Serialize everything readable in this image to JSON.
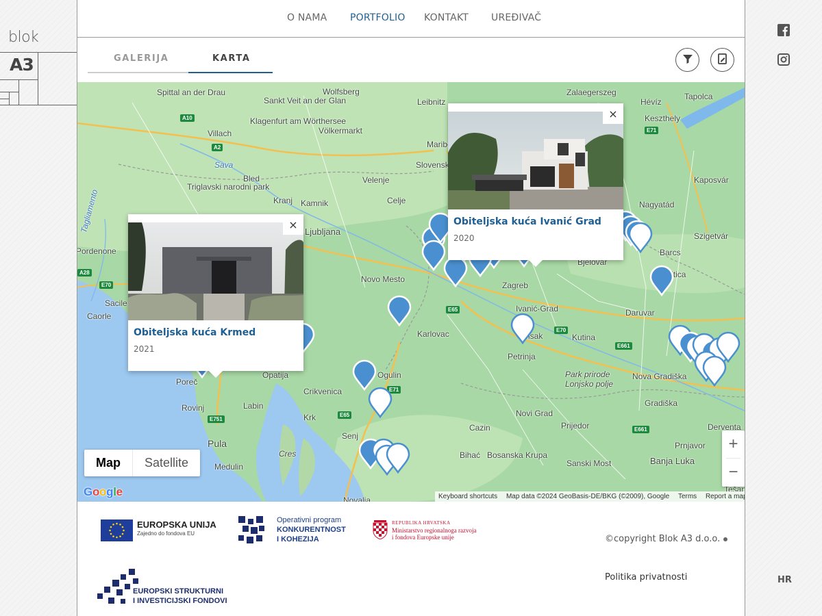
{
  "brand": {
    "line1": "blok",
    "line2": "A3"
  },
  "nav": {
    "items": [
      {
        "label": "O NAMA",
        "active": false
      },
      {
        "label": "PORTFOLIO",
        "active": true
      },
      {
        "label": "KONTAKT",
        "active": false
      },
      {
        "label": "UREĐIVAČ",
        "active": false
      }
    ]
  },
  "tabs": [
    {
      "label": "GALERIJA",
      "active": false
    },
    {
      "label": "KARTA",
      "active": true
    }
  ],
  "toolbar": {
    "filter_icon": "filter-icon",
    "document_icon": "document-edit-icon"
  },
  "map": {
    "place_labels": [
      "Spittal an der Drau",
      "Wolfsberg",
      "Leibnitz",
      "Zalaegerszeg",
      "Hévíz",
      "Tapolca",
      "Sankt Veit an der Glan",
      "Keszthely",
      "Villach",
      "Klagenfurt am Wörthersee",
      "Völkermarkt",
      "Maribor",
      "Slovenska Bistrica",
      "Sava",
      "Bled",
      "Triglavski narodni park",
      "Velenje",
      "Celje",
      "Kaposvár",
      "Kranj",
      "Kamnik",
      "Nagyatád",
      "Ljubljana",
      "Tagliamento",
      "Szigetvár",
      "Novo Mesto",
      "Barcs",
      "Bjelovar",
      "Virovitica",
      "Sacile",
      "Caorle",
      "Zagreb",
      "Ivanić-Grad",
      "Daruvar",
      "Karlovac",
      "Sisak",
      "Kutina",
      "Poreč",
      "Opatija",
      "Petrinja",
      "Park prirode Lonjsko polje",
      "Nova Gradiška",
      "Rovinj",
      "Crikvenica",
      "Ogulin",
      "Gradiška",
      "Labin",
      "Krk",
      "Novi Grad",
      "Derventa",
      "Senj",
      "Cazin",
      "Prijedor",
      "Pula",
      "Prnjavor",
      "Cres",
      "Bihać",
      "Bosanska Krupa",
      "Sanski Most",
      "Banja Luka",
      "Medulin",
      "Novalja",
      "Tešanj",
      "Pordenone"
    ],
    "road_labels": [
      "A10",
      "A2",
      "A28",
      "E70",
      "E65",
      "E71",
      "E751",
      "E661",
      "E65",
      "E70",
      "E661",
      "E71"
    ],
    "map_type": {
      "map": "Map",
      "satellite": "Satellite"
    },
    "zoom": {
      "in": "+",
      "out": "−"
    },
    "google": "Google",
    "attribution": {
      "shortcuts": "Keyboard shortcuts",
      "data": "Map data ©2024 GeoBasis-DE/BKG (©2009), Google",
      "terms": "Terms",
      "report": "Report a map error"
    },
    "marker_colors": {
      "filled": "#4a90d0",
      "outline": "#4a90d0"
    }
  },
  "popups": [
    {
      "title": "Obiteljska kuća Ivanić Grad",
      "year": "2020",
      "close": "×"
    },
    {
      "title": "Obiteljska kuća Krmed",
      "year": "2021",
      "close": "×"
    }
  ],
  "footer": {
    "eu": {
      "title": "EUROPSKA UNIJA",
      "subtitle": "Zajedno do fondova EU"
    },
    "op": {
      "line1": "Operativni program",
      "line2": "KONKURENTNOST",
      "line3": "I KOHEZIJA"
    },
    "rh": {
      "line1": "REPUBLIKA HRVATSKA",
      "line2": "Ministarstvo regionalnoga razvoja",
      "line3": "i fondova Europske unije"
    },
    "esif": {
      "line1": "EUROPSKI STRUKTURNI",
      "line2": "I INVESTICIJSKI FONDOVI"
    },
    "copyright": "©copyright Blok A3 d.o.o.",
    "privacy": "Politika privatnosti"
  },
  "social": {
    "facebook": "facebook-icon",
    "instagram": "instagram-icon"
  },
  "language": "HR"
}
